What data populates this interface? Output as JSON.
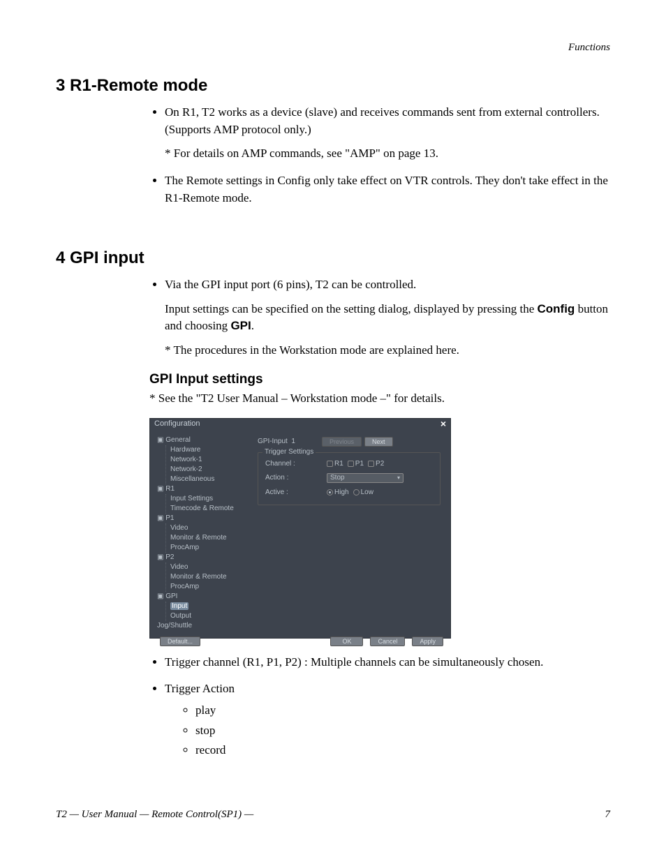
{
  "header_running": "Functions",
  "sec3": {
    "title": "3  R1-Remote mode",
    "items": [
      {
        "text": "On R1, T2 works as a device (slave) and receives commands sent from external controllers.(Supports AMP protocol only.)",
        "sub": "* For details on AMP commands, see \"AMP\" on page 13."
      },
      {
        "text": "The Remote settings in Config only take effect on VTR controls. They don't take effect in the R1-Remote mode."
      }
    ]
  },
  "sec4": {
    "title": "4  GPI input",
    "items": [
      {
        "text": "Via the GPI input port (6 pins), T2 can be controlled.",
        "para": "Input settings can be specified on the setting dialog, displayed by pressing the ",
        "para_bold1": "Config",
        "para_mid": " button and choosing ",
        "para_bold2": "GPI",
        "para_end": ".",
        "sub": "* The procedures in the Workstation mode are explained here."
      }
    ],
    "h2": "GPI Input settings",
    "h2_note": "* See the \"T2 User Manual – Workstation mode –\" for details."
  },
  "dialog": {
    "title": "Configuration",
    "close": "×",
    "tree": {
      "general": "General",
      "general_children": [
        "Hardware",
        "Network-1",
        "Network-2",
        "Miscellaneous"
      ],
      "r1": "R1",
      "r1_children": [
        "Input Settings",
        "Timecode & Remote"
      ],
      "p1": "P1",
      "p1_children": [
        "Video",
        "Monitor & Remote",
        "ProcAmp"
      ],
      "p2": "P2",
      "p2_children": [
        "Video",
        "Monitor & Remote",
        "ProcAmp"
      ],
      "gpi": "GPI",
      "gpi_children": [
        "Input",
        "Output"
      ],
      "jog": "Jog/Shuttle"
    },
    "form": {
      "gpi_label": "GPI-Input",
      "gpi_num": "1",
      "prev": "Previous",
      "next": "Next",
      "trig_legend": "Trigger Settings",
      "channel_lbl": "Channel :",
      "channel_opts": [
        "R1",
        "P1",
        "P2"
      ],
      "action_lbl": "Action :",
      "action_val": "Stop",
      "active_lbl": "Active :",
      "active_opts": [
        "High",
        "Low"
      ],
      "active_sel": "High"
    },
    "buttons": {
      "default": "Default...",
      "ok": "OK",
      "cancel": "Cancel",
      "apply": "Apply"
    }
  },
  "after": {
    "items": [
      {
        "text": "Trigger channel (R1, P1, P2) : Multiple channels can be simultaneously chosen."
      },
      {
        "text": "Trigger Action",
        "subitems": [
          "play",
          "stop",
          "record"
        ]
      }
    ]
  },
  "footer": {
    "left": "T2  —  User Manual  —  Remote Control(SP1)  —",
    "page": "7"
  }
}
